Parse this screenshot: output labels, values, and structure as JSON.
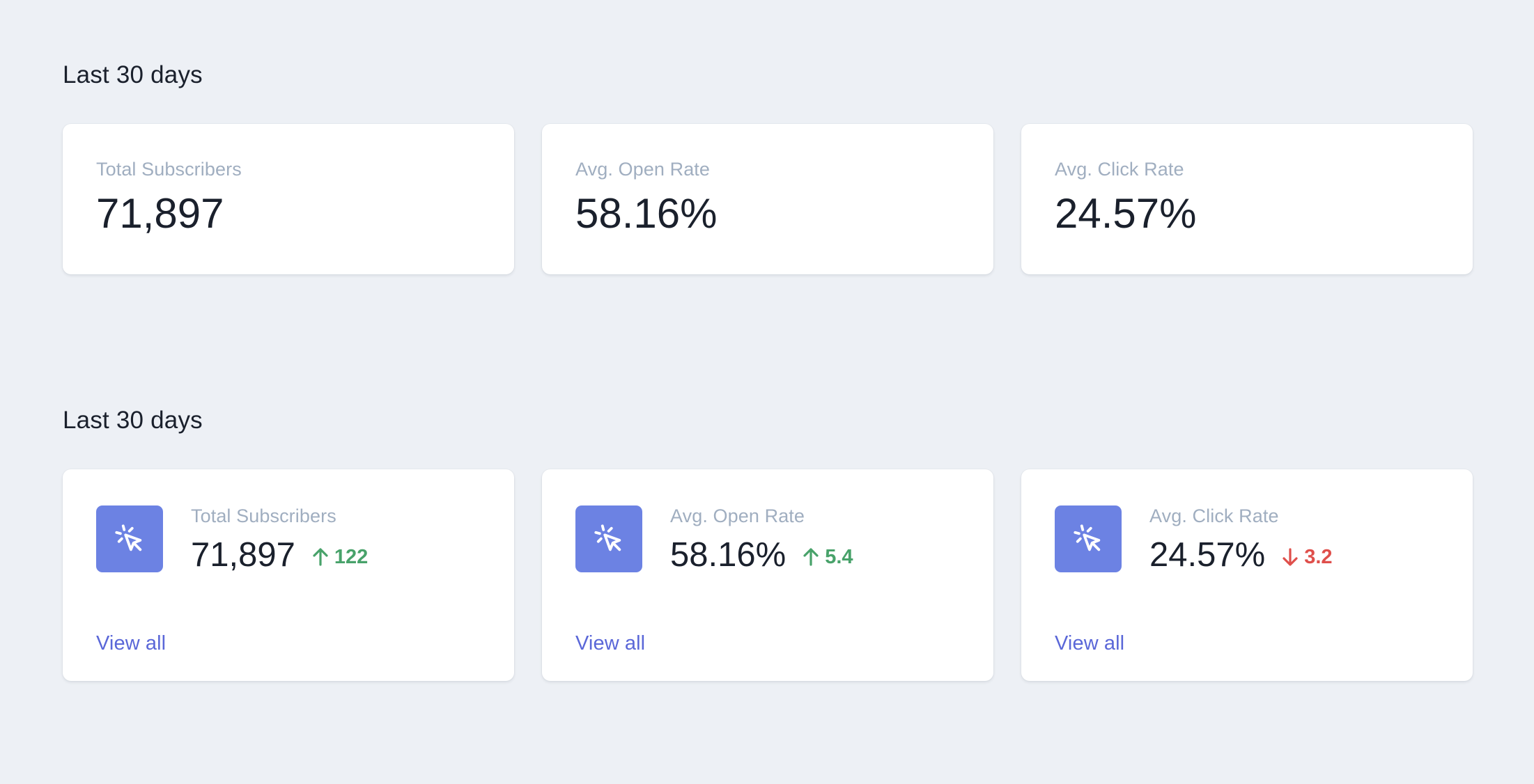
{
  "section1": {
    "title": "Last 30 days",
    "stats": [
      {
        "label": "Total Subscribers",
        "value": "71,897"
      },
      {
        "label": "Avg. Open Rate",
        "value": "58.16%"
      },
      {
        "label": "Avg. Click Rate",
        "value": "24.57%"
      }
    ]
  },
  "section2": {
    "title": "Last 30 days",
    "stats": [
      {
        "label": "Total Subscribers",
        "value": "71,897",
        "change": "122",
        "direction": "up",
        "icon": "cursor-click-icon",
        "link": "View all"
      },
      {
        "label": "Avg. Open Rate",
        "value": "58.16%",
        "change": "5.4",
        "direction": "up",
        "icon": "cursor-click-icon",
        "link": "View all"
      },
      {
        "label": "Avg. Click Rate",
        "value": "24.57%",
        "change": "3.2",
        "direction": "down",
        "icon": "cursor-click-icon",
        "link": "View all"
      }
    ]
  },
  "colors": {
    "background": "#edf0f5",
    "card": "#ffffff",
    "label": "#a0aec0",
    "value": "#1a202c",
    "icon_bg": "#6c82e3",
    "up": "#48a26a",
    "down": "#df4f4b",
    "link": "#5a67d8"
  }
}
